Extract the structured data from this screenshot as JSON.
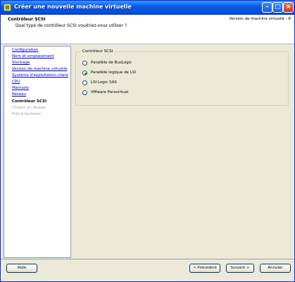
{
  "window": {
    "title": "Créer une nouvelle machine virtuelle"
  },
  "header": {
    "title": "Contrôleur SCSI",
    "subtitle": "Quel type de contrôleur SCSI voudriez-vous utiliser ?",
    "version_label": "Version de machine virtuelle : 8"
  },
  "nav": {
    "items": [
      {
        "label": "Configuration",
        "state": "link"
      },
      {
        "label": "Nom et emplacement",
        "state": "link"
      },
      {
        "label": "Stockage",
        "state": "link"
      },
      {
        "label": "Version de machine virtuelle",
        "state": "link"
      },
      {
        "label": "Système d'exploitation client",
        "state": "link"
      },
      {
        "label": "CPU",
        "state": "link"
      },
      {
        "label": "Mémoire",
        "state": "link"
      },
      {
        "label": "Réseau",
        "state": "link"
      },
      {
        "label": "Contrôleur SCSI",
        "state": "current"
      },
      {
        "label": "Choisir un disque",
        "state": "future"
      },
      {
        "label": "Prêt à terminer",
        "state": "future"
      }
    ]
  },
  "main": {
    "group_label": "Contrôleur SCSI",
    "options": [
      {
        "label": "Parallèle de BusLogic",
        "checked": false
      },
      {
        "label": "Parallèle logique de LSI",
        "checked": true
      },
      {
        "label": "LSI Logic SAS",
        "checked": false
      },
      {
        "label": "VMware Paravirtual",
        "checked": false
      }
    ]
  },
  "buttons": {
    "help": "Aide",
    "back": "< Précédent",
    "next": "Suivant >",
    "cancel": "Annuler"
  }
}
